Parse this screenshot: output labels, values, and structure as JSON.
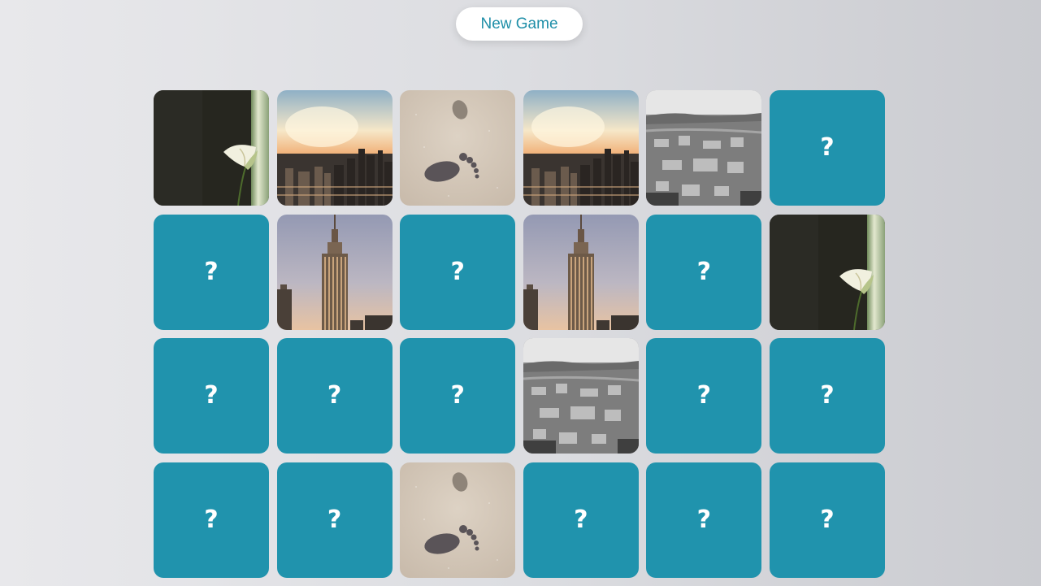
{
  "header": {
    "new_game_label": "New Game"
  },
  "board": {
    "hidden_symbol": "?",
    "rows": [
      [
        "flower",
        "chicago",
        "footprints",
        "chicago",
        "salzburg",
        "hidden"
      ],
      [
        "hidden",
        "empire",
        "hidden",
        "empire",
        "hidden",
        "flower"
      ],
      [
        "hidden",
        "hidden",
        "hidden",
        "salzburg",
        "hidden",
        "hidden"
      ],
      [
        "hidden",
        "hidden",
        "footprints",
        "hidden",
        "hidden",
        "hidden"
      ]
    ]
  },
  "colors": {
    "card_back": "#2093ad",
    "button_text": "#1f8fa8",
    "background": "#dcdde1"
  }
}
